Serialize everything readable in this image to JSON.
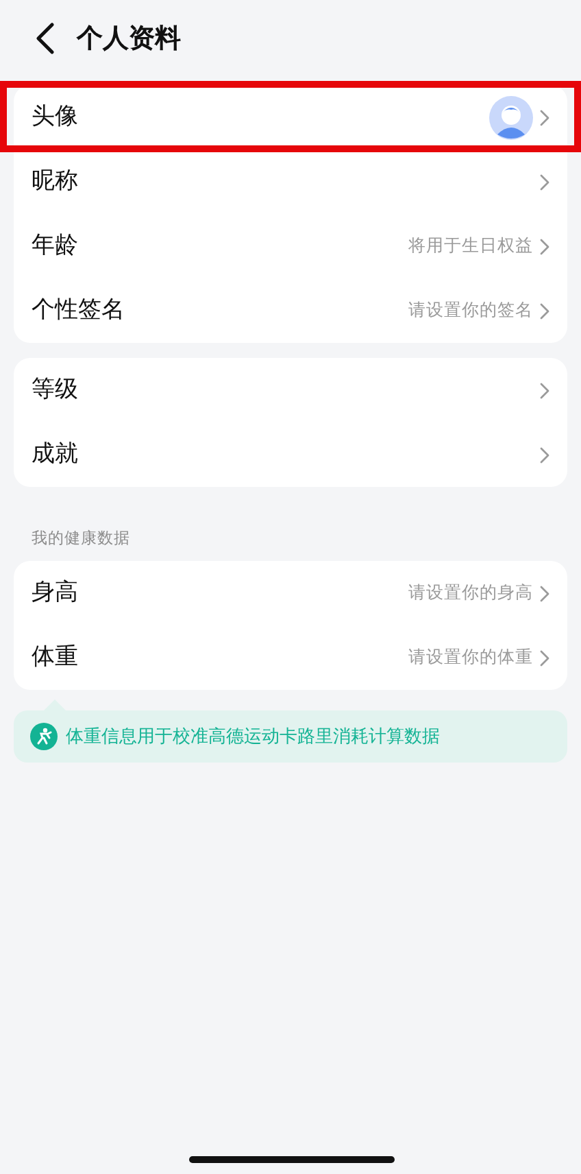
{
  "header": {
    "title": "个人资料"
  },
  "groups": [
    {
      "items": [
        {
          "kind": "avatar",
          "label": "头像",
          "highlighted": true
        },
        {
          "kind": "plain",
          "label": "昵称",
          "highlighted": false
        },
        {
          "kind": "value",
          "label": "年龄",
          "value": "将用于生日权益",
          "highlighted": false
        },
        {
          "kind": "value",
          "label": "个性签名",
          "value": "请设置你的签名",
          "highlighted": false
        }
      ]
    },
    {
      "items": [
        {
          "kind": "plain",
          "label": "等级",
          "highlighted": false
        },
        {
          "kind": "plain",
          "label": "成就",
          "highlighted": false
        }
      ]
    },
    {
      "section": "我的健康数据",
      "items": [
        {
          "kind": "value",
          "label": "身高",
          "value": "请设置你的身高",
          "highlighted": false
        },
        {
          "kind": "value",
          "label": "体重",
          "value": "请设置你的体重",
          "highlighted": false
        }
      ]
    }
  ],
  "note": {
    "text": "体重信息用于校准高德运动卡路里消耗计算数据"
  }
}
